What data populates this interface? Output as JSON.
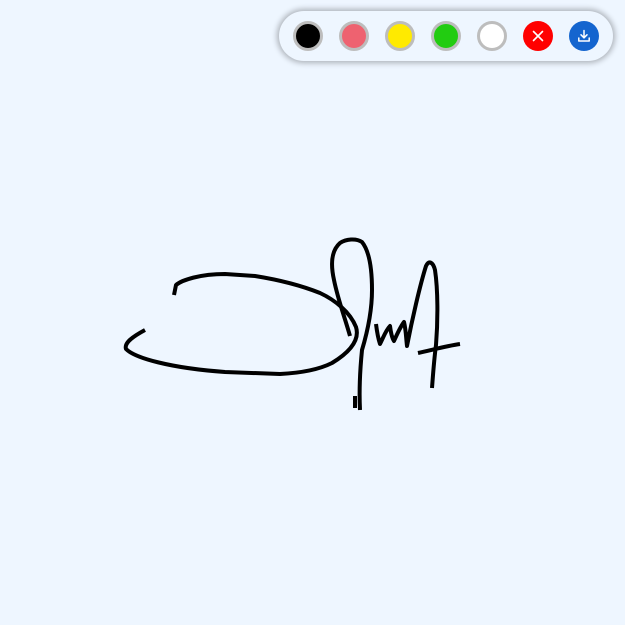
{
  "colors": {
    "background": "#eef6ff",
    "stroke": "#000000"
  },
  "toolbar": {
    "swatches": [
      {
        "name": "black",
        "color": "#000000"
      },
      {
        "name": "red",
        "color": "#ee6270"
      },
      {
        "name": "yellow",
        "color": "#ffea00"
      },
      {
        "name": "green",
        "color": "#22cc11"
      },
      {
        "name": "white",
        "color": "#ffffff"
      }
    ],
    "clear_button": {
      "icon": "close-icon",
      "color": "#ff0000"
    },
    "download_button": {
      "icon": "download-icon",
      "color": "#1465cf"
    }
  }
}
